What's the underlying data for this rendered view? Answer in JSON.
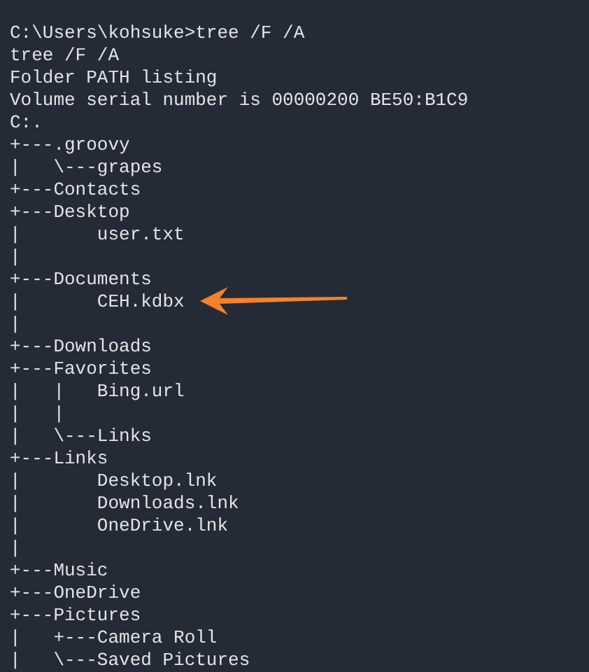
{
  "terminal": {
    "lines": [
      "C:\\Users\\kohsuke>tree /F /A",
      "tree /F /A",
      "Folder PATH listing",
      "Volume serial number is 00000200 BE50:B1C9",
      "C:.",
      "+---.groovy",
      "|   \\---grapes",
      "+---Contacts",
      "+---Desktop",
      "|       user.txt",
      "|",
      "+---Documents",
      "|       CEH.kdbx",
      "|",
      "+---Downloads",
      "+---Favorites",
      "|   |   Bing.url",
      "|   |",
      "|   \\---Links",
      "+---Links",
      "|       Desktop.lnk",
      "|       Downloads.lnk",
      "|       OneDrive.lnk",
      "|",
      "+---Music",
      "+---OneDrive",
      "+---Pictures",
      "|   +---Camera Roll",
      "|   \\---Saved Pictures"
    ]
  }
}
